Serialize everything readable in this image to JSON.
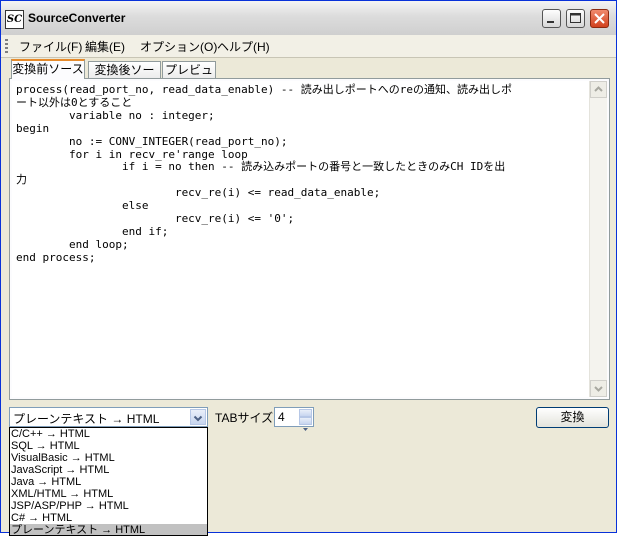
{
  "window": {
    "icon_text": "SC",
    "title": "SourceConverter"
  },
  "menu": [
    "ファイル(F)",
    "編集(E)",
    "オプション(O)",
    "ヘルプ(H)"
  ],
  "tabs": [
    "変換前ソース",
    "変換後ソース",
    "プレビュー"
  ],
  "editor": {
    "lines": [
      "process(read_port_no, read_data_enable) -- 読み出しポートへのreの通知、読み出しポ",
      "ート以外は0とすること",
      "        variable no : integer;",
      "begin",
      "        no := CONV_INTEGER(read_port_no);",
      "        for i in recv_re'range loop",
      "                if i = no then -- 読み込みポートの番号と一致したときのみCH IDを出",
      "力",
      "                        recv_re(i) <= read_data_enable;",
      "                else",
      "                        recv_re(i) <= '0';",
      "                end if;",
      "        end loop;",
      "end process;"
    ]
  },
  "controls": {
    "mode_selected": "プレーンテキスト → HTML",
    "tab_size_label": "TABサイズ:",
    "tab_size_value": "4",
    "convert_label": "変換"
  },
  "dropdown_options": [
    "C/C++ → HTML",
    "SQL → HTML",
    "VisualBasic → HTML",
    "JavaScript → HTML",
    "Java → HTML",
    "XML/HTML → HTML",
    "JSP/ASP/PHP → HTML",
    "C# → HTML",
    "プレーンテキスト → HTML"
  ]
}
